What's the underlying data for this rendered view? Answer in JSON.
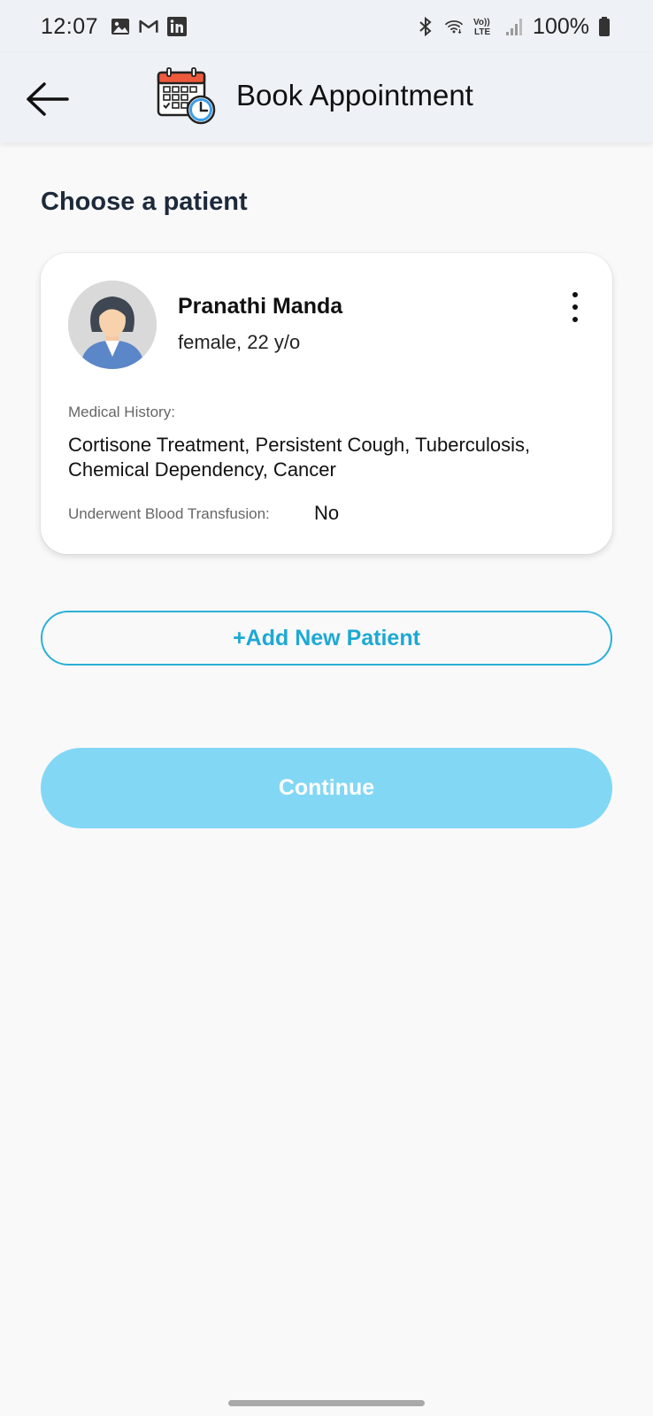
{
  "status_bar": {
    "time": "12:07",
    "left_icons": [
      "gallery-icon",
      "gmail-icon",
      "linkedin-icon"
    ],
    "right_icons": [
      "bluetooth-icon",
      "wifi-icon",
      "volte-icon",
      "signal-icon",
      "battery-icon"
    ],
    "volte_label": "Vo))\nLTE",
    "battery": "100%"
  },
  "app_bar": {
    "title": "Book Appointment",
    "back_icon": "arrow-left-icon",
    "logo_icon": "calendar-clock-icon"
  },
  "section": {
    "title": "Choose a patient"
  },
  "patient": {
    "name": "Pranathi Manda",
    "meta": "female, 22 y/o",
    "history_label": "Medical History:",
    "history_value": "Cortisone Treatment, Persistent Cough, Tuberculosis, Chemical Dependency, Cancer",
    "transfusion_label": "Underwent Blood Transfusion:",
    "transfusion_value": "No",
    "avatar_icon": "female-avatar-icon",
    "menu_icon": "more-vertical-icon"
  },
  "actions": {
    "add_patient": "+Add New Patient",
    "continue": "Continue"
  },
  "colors": {
    "accent": "#1da9d3",
    "continue_bg": "#82d7f5",
    "header_bg": "#eef1f5",
    "page_bg": "#f9f9fa"
  }
}
